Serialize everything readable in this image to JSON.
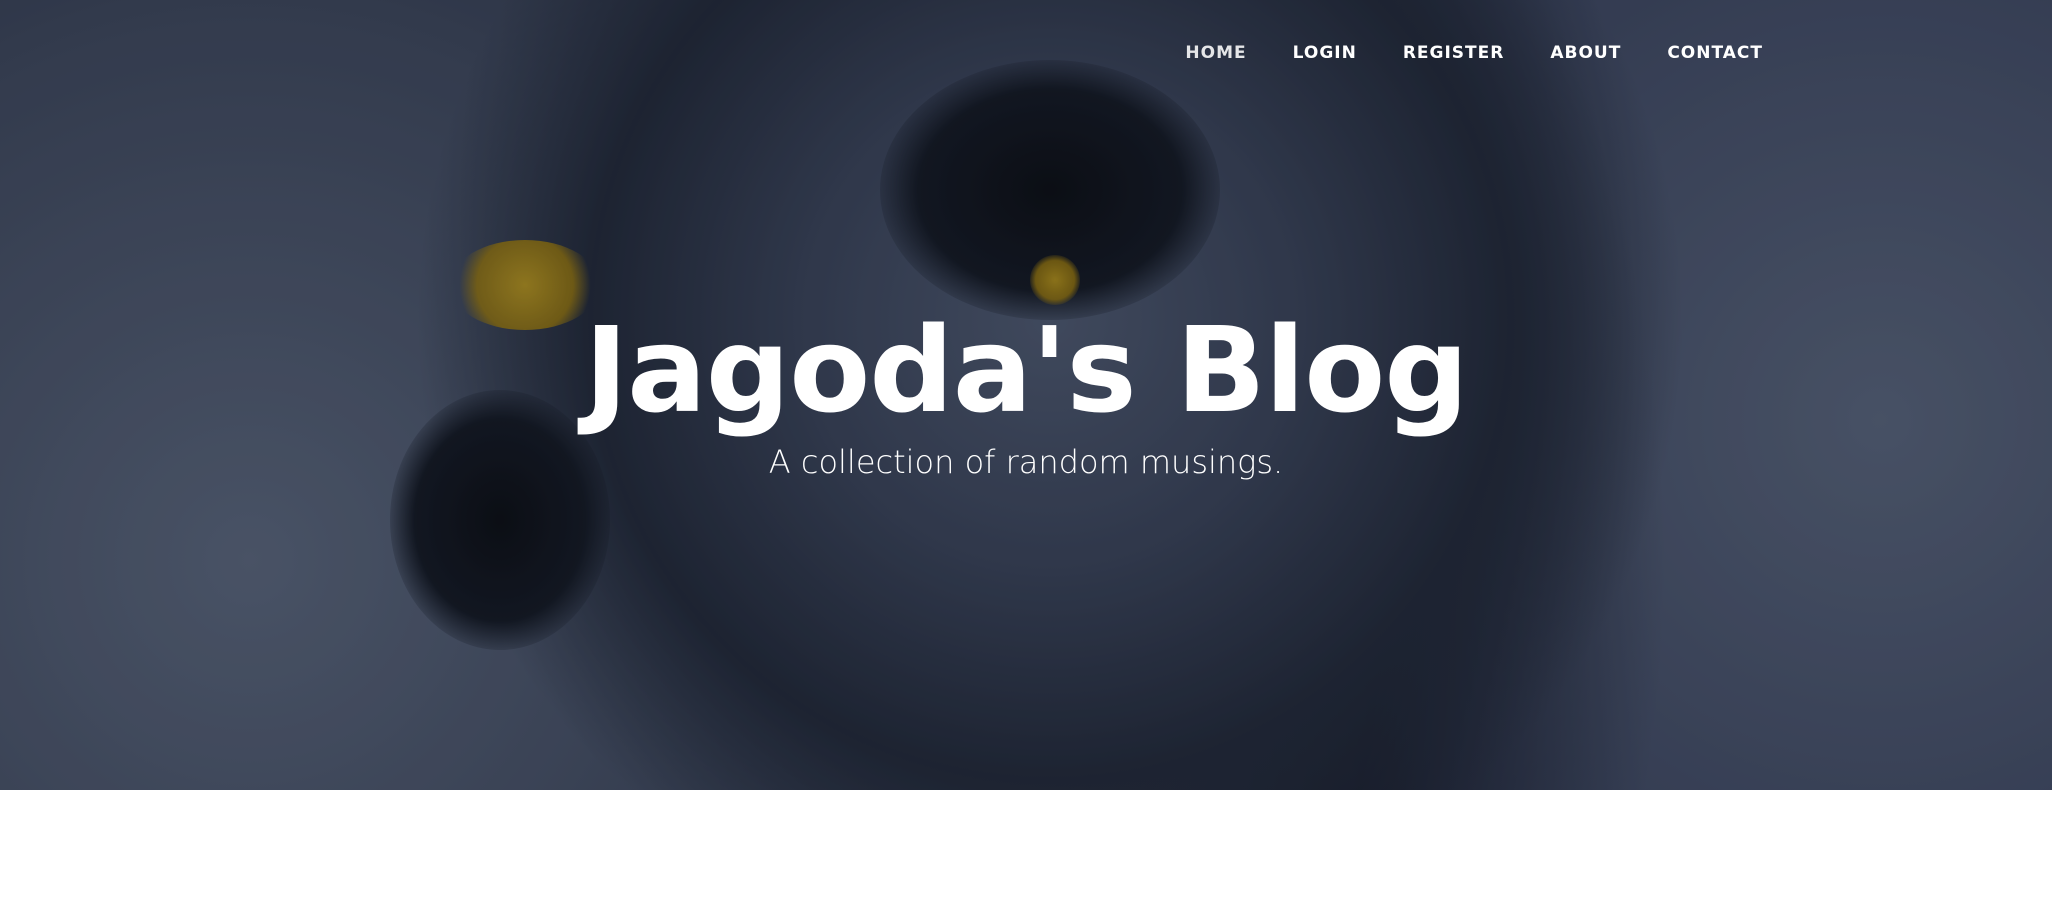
{
  "nav": {
    "items": [
      {
        "label": "HOME",
        "active": true
      },
      {
        "label": "LOGIN",
        "active": false
      },
      {
        "label": "REGISTER",
        "active": false
      },
      {
        "label": "ABOUT",
        "active": false
      },
      {
        "label": "CONTACT",
        "active": false
      }
    ]
  },
  "hero": {
    "title": "Jagoda's Blog",
    "subtitle": "A collection of random musings."
  },
  "colors": {
    "hero_text": "#ffffff",
    "page_background": "#ffffff",
    "hero_tint": "#232837"
  }
}
